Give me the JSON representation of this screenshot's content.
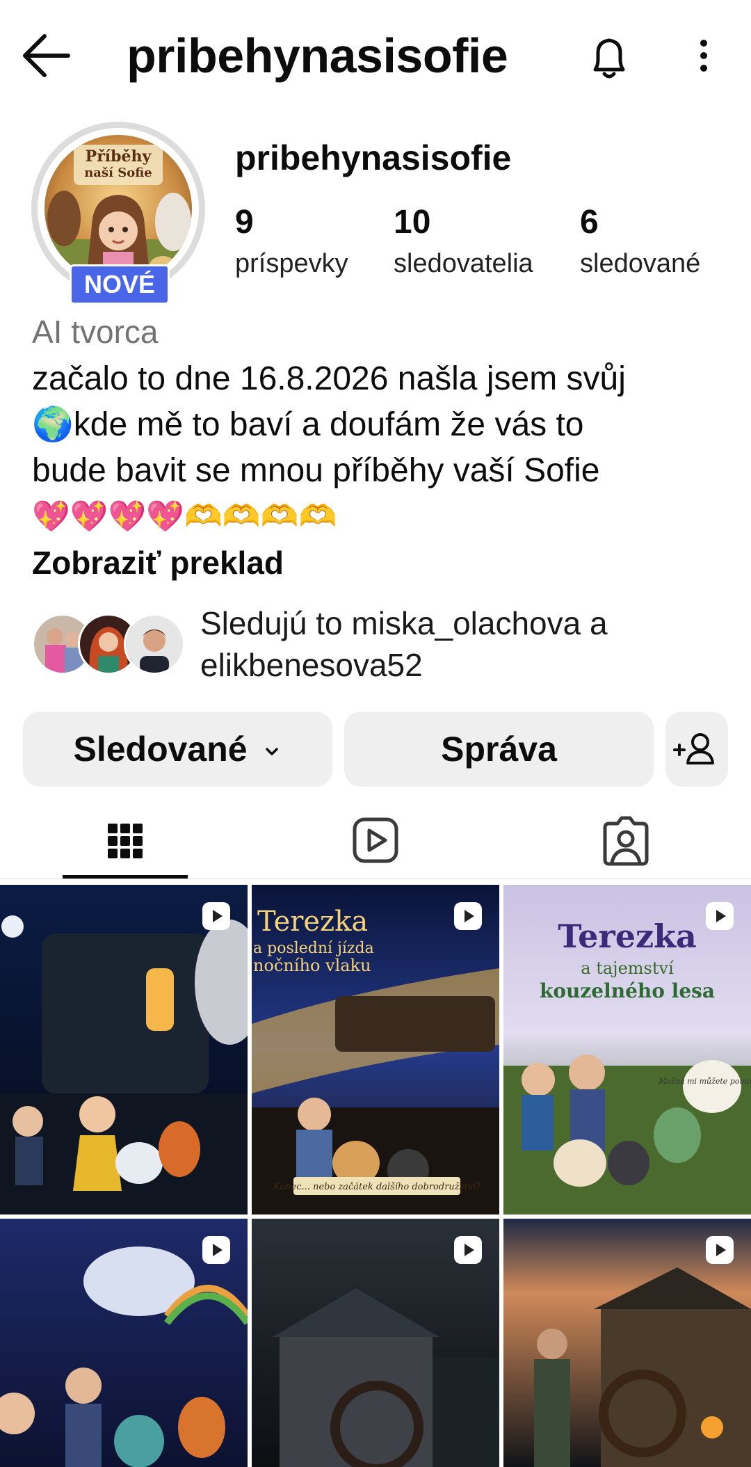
{
  "header": {
    "title": "pribehynasisofie"
  },
  "profile": {
    "username": "pribehynasisofie",
    "badge": "NOVÉ",
    "avatar_text_line1": "Příběhy",
    "avatar_text_line2": "naší Sofie",
    "stats": [
      {
        "value": "9",
        "label": "príspevky"
      },
      {
        "value": "10",
        "label": "sledovatelia"
      },
      {
        "value": "6",
        "label": "sledované"
      }
    ],
    "category": "AI tvorca",
    "bio_line1": "začalo to dne 16.8.2026 našla jsem svůj",
    "bio_line2": "🌍kde mě to baví a doufám že vás to",
    "bio_line3": "bude bavit se mnou příběhy vaší Sofie",
    "bio_line4": "💖💖💖💖🫶🫶🫶🫶",
    "translate": "Zobraziť preklad",
    "followed_by_line1": "Sledujú to miska_olachova a",
    "followed_by_line2": "elikbenesova52"
  },
  "actions": {
    "following_label": "Sledované",
    "message_label": "Správa"
  },
  "tabs": {
    "active": "posts"
  },
  "grid": {
    "posts": [
      {
        "title_line1": "",
        "title_line2": "",
        "title_line3": "",
        "footer": "",
        "bubble": ""
      },
      {
        "title_line1": "Terezka",
        "title_line2": "a poslední jízda",
        "title_line3": "nočního vlaku",
        "footer": "Konec... nebo začátek dalšího dobrodružství?",
        "bubble": ""
      },
      {
        "title_line1": "Terezka",
        "title_line2": "a tajemství",
        "title_line3": "kouzelného lesa",
        "footer": "",
        "bubble": "Možná mi můžete pomoci..."
      },
      {
        "title_line1": "",
        "title_line2": "",
        "title_line3": "",
        "footer": "",
        "bubble": ""
      },
      {
        "title_line1": "",
        "title_line2": "",
        "title_line3": "",
        "footer": "",
        "bubble": ""
      },
      {
        "title_line1": "",
        "title_line2": "",
        "title_line3": "",
        "footer": "",
        "bubble": ""
      }
    ]
  },
  "colors": {
    "badge": "#4a66e8",
    "button_bg": "#efefef",
    "muted_text": "#737373"
  }
}
